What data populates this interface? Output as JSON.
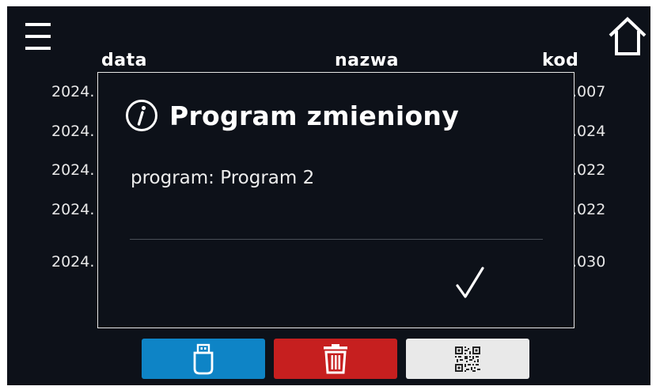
{
  "header": {
    "menu_icon": "hamburger-menu-icon",
    "home_icon": "home-icon"
  },
  "table": {
    "columns": [
      "data",
      "nazwa",
      "kod"
    ],
    "rows": [
      {
        "date": "2024.",
        "code": ".007"
      },
      {
        "date": "2024.",
        "code": ".024"
      },
      {
        "date": "2024.",
        "code": ".022"
      },
      {
        "date": "2024.",
        "code": ".022"
      },
      {
        "date": "2024.",
        "code": ".030"
      }
    ]
  },
  "dialog": {
    "icon": "info-icon",
    "title": "Program zmieniony",
    "message": "program: Program 2",
    "confirm_icon": "checkmark-icon"
  },
  "bottom_bar": {
    "buttons": [
      {
        "icon": "usb-drive-icon",
        "color": "#0e84c6"
      },
      {
        "icon": "trash-icon",
        "color": "#c61f1f"
      },
      {
        "icon": "qr-code-icon",
        "color": "#e9e9e9"
      }
    ]
  },
  "colors": {
    "background": "#0d1119",
    "text": "#ffffff",
    "dialog_border": "#e6e6e6",
    "usb_button": "#0e84c6",
    "delete_button": "#c61f1f",
    "qr_button": "#e9e9e9"
  }
}
